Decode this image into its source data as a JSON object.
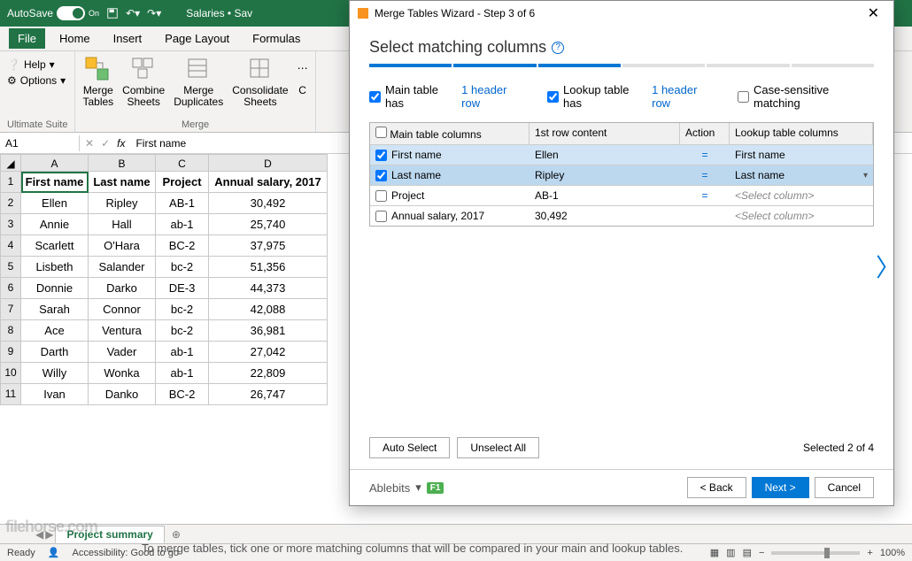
{
  "titlebar": {
    "autosave": "AutoSave",
    "autosave_on": "On",
    "doc_title": "Salaries • Sav"
  },
  "ribbon": {
    "tabs": {
      "file": "File",
      "home": "Home",
      "insert": "Insert",
      "page": "Page Layout",
      "formulas": "Formulas"
    },
    "help": "Help",
    "options": "Options",
    "group_ultimate": "Ultimate Suite",
    "group_merge": "Merge",
    "merge_tables": "Merge\nTables",
    "combine_sheets": "Combine\nSheets",
    "merge_dup": "Merge\nDuplicates",
    "consolidate": "Consolidate\nSheets"
  },
  "formula": {
    "ref": "A1",
    "fx": "fx",
    "value": "First name"
  },
  "columns": {
    "a": "A",
    "b": "B",
    "c": "C",
    "d": "D"
  },
  "headers": {
    "first": "First name",
    "last": "Last name",
    "project": "Project",
    "salary": "Annual salary, 2017"
  },
  "rows": [
    {
      "n": "1"
    },
    {
      "n": "2",
      "first": "Ellen",
      "last": "Ripley",
      "project": "AB-1",
      "salary": "30,492"
    },
    {
      "n": "3",
      "first": "Annie",
      "last": "Hall",
      "project": "ab-1",
      "salary": "25,740"
    },
    {
      "n": "4",
      "first": "Scarlett",
      "last": "O'Hara",
      "project": "BC-2",
      "salary": "37,975"
    },
    {
      "n": "5",
      "first": "Lisbeth",
      "last": "Salander",
      "project": "bc-2",
      "salary": "51,356"
    },
    {
      "n": "6",
      "first": "Donnie",
      "last": "Darko",
      "project": "DE-3",
      "salary": "44,373"
    },
    {
      "n": "7",
      "first": "Sarah",
      "last": "Connor",
      "project": "bc-2",
      "salary": "42,088"
    },
    {
      "n": "8",
      "first": "Ace",
      "last": "Ventura",
      "project": "bc-2",
      "salary": "36,981"
    },
    {
      "n": "9",
      "first": "Darth",
      "last": "Vader",
      "project": "ab-1",
      "salary": "27,042"
    },
    {
      "n": "10",
      "first": "Willy",
      "last": "Wonka",
      "project": "ab-1",
      "salary": "22,809"
    },
    {
      "n": "11",
      "first": "Ivan",
      "last": "Danko",
      "project": "BC-2",
      "salary": "26,747"
    }
  ],
  "sheet": {
    "name": "Project summary",
    "add": "⊕"
  },
  "status": {
    "ready": "Ready",
    "access": "Accessibility: Good to go",
    "zoom": "100%"
  },
  "dialog": {
    "title": "Merge Tables Wizard - Step 3 of 6",
    "heading": "Select matching columns",
    "opt_main_a": "Main table has",
    "opt_main_b": "1 header row",
    "opt_lookup_a": "Lookup table has",
    "opt_lookup_b": "1 header row",
    "opt_case": "Case-sensitive matching",
    "th_main": "Main table columns",
    "th_first": "1st row content",
    "th_action": "Action",
    "th_lookup": "Lookup table columns",
    "mrows": [
      {
        "checked": true,
        "main": "First name",
        "first": "Ellen",
        "action": "=",
        "lookup": "First name",
        "sel": true
      },
      {
        "checked": true,
        "main": "Last name",
        "first": "Ripley",
        "action": "=",
        "lookup": "Last name",
        "sel": true,
        "active": true
      },
      {
        "checked": false,
        "main": "Project",
        "first": "AB-1",
        "action": "=",
        "lookup": "<Select column>"
      },
      {
        "checked": false,
        "main": "Annual salary, 2017",
        "first": "30,492",
        "action": "",
        "lookup": "<Select column>"
      }
    ],
    "auto": "Auto Select",
    "unselect": "Unselect All",
    "selected": "Selected 2 of 4",
    "brand": "Ablebits",
    "f1": "F1",
    "back": "< Back",
    "next": "Next >",
    "cancel": "Cancel"
  },
  "caption": "To merge tables, tick one or more matching columns that will be compared in your main and lookup tables.",
  "watermark": "filehorse.com"
}
